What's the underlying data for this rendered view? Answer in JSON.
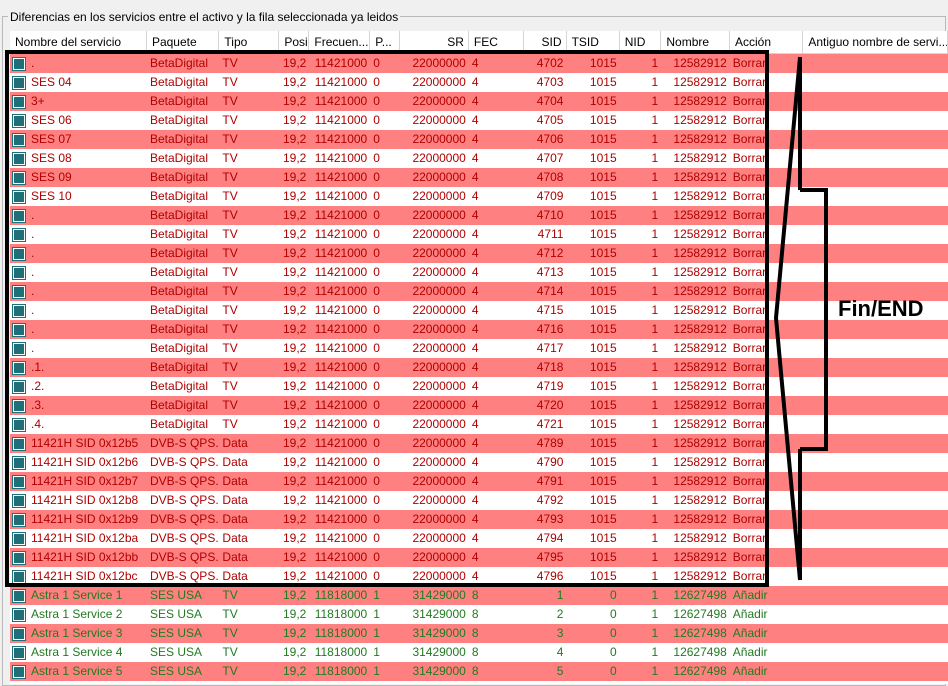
{
  "group_title": "Diferencias en los servicios entre el activo y la fila seleccionada ya leidos",
  "columns": [
    {
      "label": "Nombre del servicio",
      "w": 142,
      "align": "left"
    },
    {
      "label": "Paquete",
      "w": 75,
      "align": "left"
    },
    {
      "label": "Tipo",
      "w": 62,
      "align": "left"
    },
    {
      "label": "Posici...",
      "w": 31,
      "align": "left"
    },
    {
      "label": "Frecuen...",
      "w": 63,
      "align": "left"
    },
    {
      "label": "P...",
      "w": 31,
      "align": "left"
    },
    {
      "label": "SR",
      "w": 71,
      "align": "right"
    },
    {
      "label": "FEC",
      "w": 57,
      "align": "left"
    },
    {
      "label": "SID",
      "w": 44,
      "align": "right"
    },
    {
      "label": "TSID",
      "w": 55,
      "align": "left"
    },
    {
      "label": "NID",
      "w": 43,
      "align": "left"
    },
    {
      "label": "Nombre",
      "w": 71,
      "align": "left"
    },
    {
      "label": "Acción",
      "w": 76,
      "align": "left"
    },
    {
      "label": "Antiguo nombre de servi...",
      "w": 150,
      "align": "left"
    }
  ],
  "rows": [
    {
      "name": ".",
      "paquete": "BetaDigital",
      "tipo": "TV",
      "pos": "19,2",
      "freq": "11421000",
      "p": "0",
      "sr": "22000000",
      "fec": "4",
      "sid": "4702",
      "tsid": "1015",
      "nid": "1",
      "nombre": "12582912",
      "accion": "Borrar",
      "old": "",
      "bg": "pink",
      "kind": "del"
    },
    {
      "name": "SES 04",
      "paquete": "BetaDigital",
      "tipo": "TV",
      "pos": "19,2",
      "freq": "11421000",
      "p": "0",
      "sr": "22000000",
      "fec": "4",
      "sid": "4703",
      "tsid": "1015",
      "nid": "1",
      "nombre": "12582912",
      "accion": "Borrar",
      "old": "",
      "bg": "white",
      "kind": "del"
    },
    {
      "name": "3+",
      "paquete": "BetaDigital",
      "tipo": "TV",
      "pos": "19,2",
      "freq": "11421000",
      "p": "0",
      "sr": "22000000",
      "fec": "4",
      "sid": "4704",
      "tsid": "1015",
      "nid": "1",
      "nombre": "12582912",
      "accion": "Borrar",
      "old": "",
      "bg": "pink",
      "kind": "del"
    },
    {
      "name": "SES 06",
      "paquete": "BetaDigital",
      "tipo": "TV",
      "pos": "19,2",
      "freq": "11421000",
      "p": "0",
      "sr": "22000000",
      "fec": "4",
      "sid": "4705",
      "tsid": "1015",
      "nid": "1",
      "nombre": "12582912",
      "accion": "Borrar",
      "old": "",
      "bg": "white",
      "kind": "del"
    },
    {
      "name": "SES 07",
      "paquete": "BetaDigital",
      "tipo": "TV",
      "pos": "19,2",
      "freq": "11421000",
      "p": "0",
      "sr": "22000000",
      "fec": "4",
      "sid": "4706",
      "tsid": "1015",
      "nid": "1",
      "nombre": "12582912",
      "accion": "Borrar",
      "old": "",
      "bg": "pink",
      "kind": "del"
    },
    {
      "name": "SES 08",
      "paquete": "BetaDigital",
      "tipo": "TV",
      "pos": "19,2",
      "freq": "11421000",
      "p": "0",
      "sr": "22000000",
      "fec": "4",
      "sid": "4707",
      "tsid": "1015",
      "nid": "1",
      "nombre": "12582912",
      "accion": "Borrar",
      "old": "",
      "bg": "white",
      "kind": "del"
    },
    {
      "name": "SES 09",
      "paquete": "BetaDigital",
      "tipo": "TV",
      "pos": "19,2",
      "freq": "11421000",
      "p": "0",
      "sr": "22000000",
      "fec": "4",
      "sid": "4708",
      "tsid": "1015",
      "nid": "1",
      "nombre": "12582912",
      "accion": "Borrar",
      "old": "",
      "bg": "pink",
      "kind": "del"
    },
    {
      "name": "SES 10",
      "paquete": "BetaDigital",
      "tipo": "TV",
      "pos": "19,2",
      "freq": "11421000",
      "p": "0",
      "sr": "22000000",
      "fec": "4",
      "sid": "4709",
      "tsid": "1015",
      "nid": "1",
      "nombre": "12582912",
      "accion": "Borrar",
      "old": "",
      "bg": "white",
      "kind": "del"
    },
    {
      "name": ".",
      "paquete": "BetaDigital",
      "tipo": "TV",
      "pos": "19,2",
      "freq": "11421000",
      "p": "0",
      "sr": "22000000",
      "fec": "4",
      "sid": "4710",
      "tsid": "1015",
      "nid": "1",
      "nombre": "12582912",
      "accion": "Borrar",
      "old": "",
      "bg": "pink",
      "kind": "del"
    },
    {
      "name": ".",
      "paquete": "BetaDigital",
      "tipo": "TV",
      "pos": "19,2",
      "freq": "11421000",
      "p": "0",
      "sr": "22000000",
      "fec": "4",
      "sid": "4711",
      "tsid": "1015",
      "nid": "1",
      "nombre": "12582912",
      "accion": "Borrar",
      "old": "",
      "bg": "white",
      "kind": "del"
    },
    {
      "name": ".",
      "paquete": "BetaDigital",
      "tipo": "TV",
      "pos": "19,2",
      "freq": "11421000",
      "p": "0",
      "sr": "22000000",
      "fec": "4",
      "sid": "4712",
      "tsid": "1015",
      "nid": "1",
      "nombre": "12582912",
      "accion": "Borrar",
      "old": "",
      "bg": "pink",
      "kind": "del"
    },
    {
      "name": ".",
      "paquete": "BetaDigital",
      "tipo": "TV",
      "pos": "19,2",
      "freq": "11421000",
      "p": "0",
      "sr": "22000000",
      "fec": "4",
      "sid": "4713",
      "tsid": "1015",
      "nid": "1",
      "nombre": "12582912",
      "accion": "Borrar",
      "old": "",
      "bg": "white",
      "kind": "del"
    },
    {
      "name": ".",
      "paquete": "BetaDigital",
      "tipo": "TV",
      "pos": "19,2",
      "freq": "11421000",
      "p": "0",
      "sr": "22000000",
      "fec": "4",
      "sid": "4714",
      "tsid": "1015",
      "nid": "1",
      "nombre": "12582912",
      "accion": "Borrar",
      "old": "",
      "bg": "pink",
      "kind": "del"
    },
    {
      "name": ".",
      "paquete": "BetaDigital",
      "tipo": "TV",
      "pos": "19,2",
      "freq": "11421000",
      "p": "0",
      "sr": "22000000",
      "fec": "4",
      "sid": "4715",
      "tsid": "1015",
      "nid": "1",
      "nombre": "12582912",
      "accion": "Borrar",
      "old": "",
      "bg": "white",
      "kind": "del"
    },
    {
      "name": ".",
      "paquete": "BetaDigital",
      "tipo": "TV",
      "pos": "19,2",
      "freq": "11421000",
      "p": "0",
      "sr": "22000000",
      "fec": "4",
      "sid": "4716",
      "tsid": "1015",
      "nid": "1",
      "nombre": "12582912",
      "accion": "Borrar",
      "old": "",
      "bg": "pink",
      "kind": "del"
    },
    {
      "name": ".",
      "paquete": "BetaDigital",
      "tipo": "TV",
      "pos": "19,2",
      "freq": "11421000",
      "p": "0",
      "sr": "22000000",
      "fec": "4",
      "sid": "4717",
      "tsid": "1015",
      "nid": "1",
      "nombre": "12582912",
      "accion": "Borrar",
      "old": "",
      "bg": "white",
      "kind": "del"
    },
    {
      "name": ".1.",
      "paquete": "BetaDigital",
      "tipo": "TV",
      "pos": "19,2",
      "freq": "11421000",
      "p": "0",
      "sr": "22000000",
      "fec": "4",
      "sid": "4718",
      "tsid": "1015",
      "nid": "1",
      "nombre": "12582912",
      "accion": "Borrar",
      "old": "",
      "bg": "pink",
      "kind": "del"
    },
    {
      "name": ".2.",
      "paquete": "BetaDigital",
      "tipo": "TV",
      "pos": "19,2",
      "freq": "11421000",
      "p": "0",
      "sr": "22000000",
      "fec": "4",
      "sid": "4719",
      "tsid": "1015",
      "nid": "1",
      "nombre": "12582912",
      "accion": "Borrar",
      "old": "",
      "bg": "white",
      "kind": "del"
    },
    {
      "name": ".3.",
      "paquete": "BetaDigital",
      "tipo": "TV",
      "pos": "19,2",
      "freq": "11421000",
      "p": "0",
      "sr": "22000000",
      "fec": "4",
      "sid": "4720",
      "tsid": "1015",
      "nid": "1",
      "nombre": "12582912",
      "accion": "Borrar",
      "old": "",
      "bg": "pink",
      "kind": "del"
    },
    {
      "name": ".4.",
      "paquete": "BetaDigital",
      "tipo": "TV",
      "pos": "19,2",
      "freq": "11421000",
      "p": "0",
      "sr": "22000000",
      "fec": "4",
      "sid": "4721",
      "tsid": "1015",
      "nid": "1",
      "nombre": "12582912",
      "accion": "Borrar",
      "old": "",
      "bg": "white",
      "kind": "del"
    },
    {
      "name": "11421H SID 0x12b5",
      "paquete": "DVB-S QPS...",
      "tipo": "Data",
      "pos": "19,2",
      "freq": "11421000",
      "p": "0",
      "sr": "22000000",
      "fec": "4",
      "sid": "4789",
      "tsid": "1015",
      "nid": "1",
      "nombre": "12582912",
      "accion": "Borrar",
      "old": "",
      "bg": "pink",
      "kind": "del"
    },
    {
      "name": "11421H SID 0x12b6",
      "paquete": "DVB-S QPS...",
      "tipo": "Data",
      "pos": "19,2",
      "freq": "11421000",
      "p": "0",
      "sr": "22000000",
      "fec": "4",
      "sid": "4790",
      "tsid": "1015",
      "nid": "1",
      "nombre": "12582912",
      "accion": "Borrar",
      "old": "",
      "bg": "white",
      "kind": "del"
    },
    {
      "name": "11421H SID 0x12b7",
      "paquete": "DVB-S QPS...",
      "tipo": "Data",
      "pos": "19,2",
      "freq": "11421000",
      "p": "0",
      "sr": "22000000",
      "fec": "4",
      "sid": "4791",
      "tsid": "1015",
      "nid": "1",
      "nombre": "12582912",
      "accion": "Borrar",
      "old": "",
      "bg": "pink",
      "kind": "del"
    },
    {
      "name": "11421H SID 0x12b8",
      "paquete": "DVB-S QPS...",
      "tipo": "Data",
      "pos": "19,2",
      "freq": "11421000",
      "p": "0",
      "sr": "22000000",
      "fec": "4",
      "sid": "4792",
      "tsid": "1015",
      "nid": "1",
      "nombre": "12582912",
      "accion": "Borrar",
      "old": "",
      "bg": "white",
      "kind": "del"
    },
    {
      "name": "11421H SID 0x12b9",
      "paquete": "DVB-S QPS...",
      "tipo": "Data",
      "pos": "19,2",
      "freq": "11421000",
      "p": "0",
      "sr": "22000000",
      "fec": "4",
      "sid": "4793",
      "tsid": "1015",
      "nid": "1",
      "nombre": "12582912",
      "accion": "Borrar",
      "old": "",
      "bg": "pink",
      "kind": "del"
    },
    {
      "name": "11421H SID 0x12ba",
      "paquete": "DVB-S QPS...",
      "tipo": "Data",
      "pos": "19,2",
      "freq": "11421000",
      "p": "0",
      "sr": "22000000",
      "fec": "4",
      "sid": "4794",
      "tsid": "1015",
      "nid": "1",
      "nombre": "12582912",
      "accion": "Borrar",
      "old": "",
      "bg": "white",
      "kind": "del"
    },
    {
      "name": "11421H SID 0x12bb",
      "paquete": "DVB-S QPS...",
      "tipo": "Data",
      "pos": "19,2",
      "freq": "11421000",
      "p": "0",
      "sr": "22000000",
      "fec": "4",
      "sid": "4795",
      "tsid": "1015",
      "nid": "1",
      "nombre": "12582912",
      "accion": "Borrar",
      "old": "",
      "bg": "pink",
      "kind": "del"
    },
    {
      "name": "11421H SID 0x12bc",
      "paquete": "DVB-S QPS...",
      "tipo": "Data",
      "pos": "19,2",
      "freq": "11421000",
      "p": "0",
      "sr": "22000000",
      "fec": "4",
      "sid": "4796",
      "tsid": "1015",
      "nid": "1",
      "nombre": "12582912",
      "accion": "Borrar",
      "old": "",
      "bg": "white",
      "kind": "del"
    },
    {
      "name": "Astra 1 Service 1",
      "paquete": "SES USA",
      "tipo": "TV",
      "pos": "19,2",
      "freq": "11818000",
      "p": "1",
      "sr": "31429000",
      "fec": "8",
      "sid": "1",
      "tsid": "0",
      "nid": "1",
      "nombre": "12627498",
      "accion": "Añadir",
      "old": "",
      "bg": "pink",
      "kind": "add"
    },
    {
      "name": "Astra 1 Service 2",
      "paquete": "SES USA",
      "tipo": "TV",
      "pos": "19,2",
      "freq": "11818000",
      "p": "1",
      "sr": "31429000",
      "fec": "8",
      "sid": "2",
      "tsid": "0",
      "nid": "1",
      "nombre": "12627498",
      "accion": "Añadir",
      "old": "",
      "bg": "white",
      "kind": "add"
    },
    {
      "name": "Astra 1 Service 3",
      "paquete": "SES USA",
      "tipo": "TV",
      "pos": "19,2",
      "freq": "11818000",
      "p": "1",
      "sr": "31429000",
      "fec": "8",
      "sid": "3",
      "tsid": "0",
      "nid": "1",
      "nombre": "12627498",
      "accion": "Añadir",
      "old": "",
      "bg": "pink",
      "kind": "add"
    },
    {
      "name": "Astra 1 Service 4",
      "paquete": "SES USA",
      "tipo": "TV",
      "pos": "19,2",
      "freq": "11818000",
      "p": "1",
      "sr": "31429000",
      "fec": "8",
      "sid": "4",
      "tsid": "0",
      "nid": "1",
      "nombre": "12627498",
      "accion": "Añadir",
      "old": "",
      "bg": "white",
      "kind": "add"
    },
    {
      "name": "Astra 1 Service 5",
      "paquete": "SES USA",
      "tipo": "TV",
      "pos": "19,2",
      "freq": "11818000",
      "p": "1",
      "sr": "31429000",
      "fec": "8",
      "sid": "5",
      "tsid": "0",
      "nid": "1",
      "nombre": "12627498",
      "accion": "Añadir",
      "old": "",
      "bg": "pink",
      "kind": "add"
    }
  ],
  "annotation": {
    "text": "Fin/END"
  },
  "colors": {
    "row_pink": "#ff8080",
    "row_white": "#ffffff",
    "delete_text": "#b00000",
    "add_text": "#217a21",
    "service_icon": "#1e6f78"
  },
  "icons": {
    "row_icon": "service-icon"
  }
}
